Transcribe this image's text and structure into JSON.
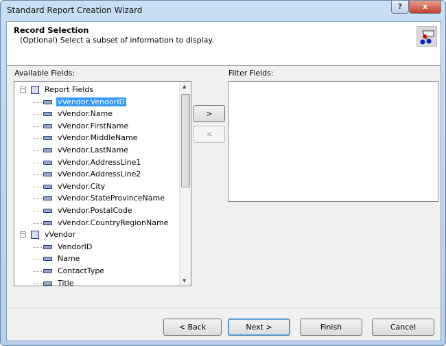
{
  "window": {
    "title": "Standard Report Creation Wizard",
    "help_label": "?",
    "close_label": "x"
  },
  "header": {
    "title": "Record Selection",
    "subtitle": "(Optional)  Select a subset of information to display.",
    "icon": "record-selection-icon"
  },
  "available": {
    "label": "Available Fields:",
    "groups": [
      {
        "label": "Report Fields",
        "expander": "−",
        "items": [
          "vVendor.VendorID",
          "vVendor.Name",
          "vVendor.FirstName",
          "vVendor.MiddleName",
          "vVendor.LastName",
          "vVendor.AddressLine1",
          "vVendor.AddressLine2",
          "vVendor.City",
          "vVendor.StateProvinceName",
          "vVendor.PostalCode",
          "vVendor.CountryRegionName"
        ]
      },
      {
        "label": "vVendor",
        "expander": "−",
        "items": [
          "VendorID",
          "Name",
          "ContactType",
          "Title"
        ]
      }
    ],
    "selected": "vVendor.VendorID"
  },
  "transfer": {
    "add": ">",
    "remove": "<"
  },
  "filter": {
    "label": "Filter Fields:"
  },
  "footer": {
    "back": "< Back",
    "next": "Next >",
    "finish": "Finish",
    "cancel": "Cancel"
  }
}
